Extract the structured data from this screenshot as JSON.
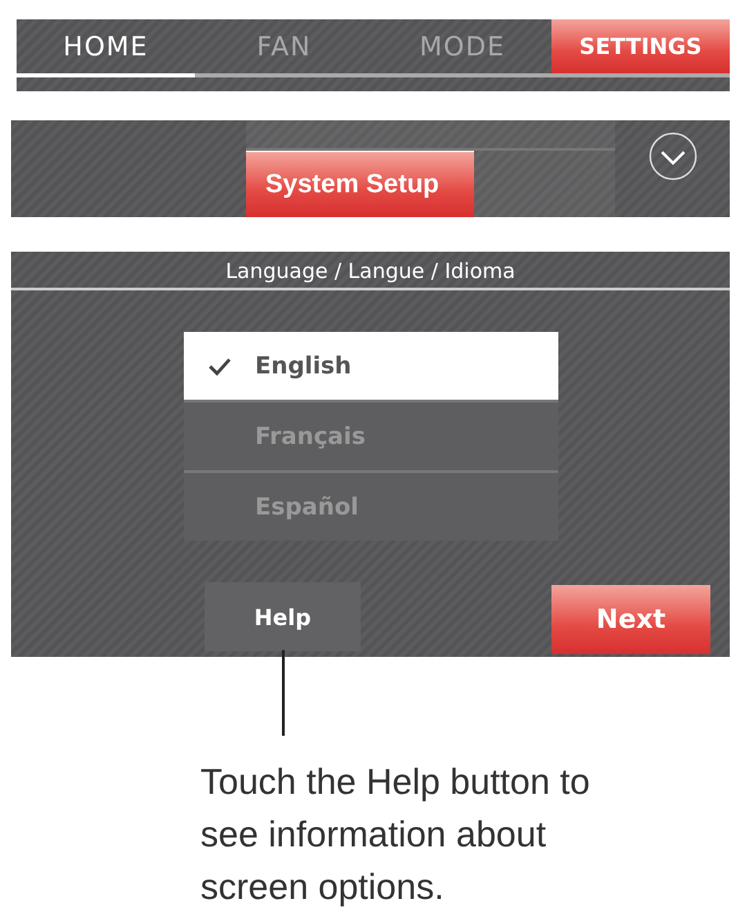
{
  "tabs": [
    {
      "label": "HOME",
      "selected": false,
      "underlined": true
    },
    {
      "label": "FAN",
      "selected": false,
      "underlined": false
    },
    {
      "label": "MODE",
      "selected": false,
      "underlined": false
    },
    {
      "label": "SETTINGS",
      "selected": true,
      "underlined": false
    }
  ],
  "menu": {
    "items": [
      {
        "label": "System Setup",
        "selected": true
      }
    ]
  },
  "dialog": {
    "title": "Language / Langue / Idioma",
    "options": [
      {
        "label": "English",
        "selected": true
      },
      {
        "label": "Français",
        "selected": false
      },
      {
        "label": "Español",
        "selected": false
      }
    ],
    "buttons": [
      {
        "label": "Help",
        "kind": "secondary"
      },
      {
        "label": "Next",
        "kind": "primary"
      }
    ]
  },
  "callout": "Touch the Help button to see information about screen options."
}
